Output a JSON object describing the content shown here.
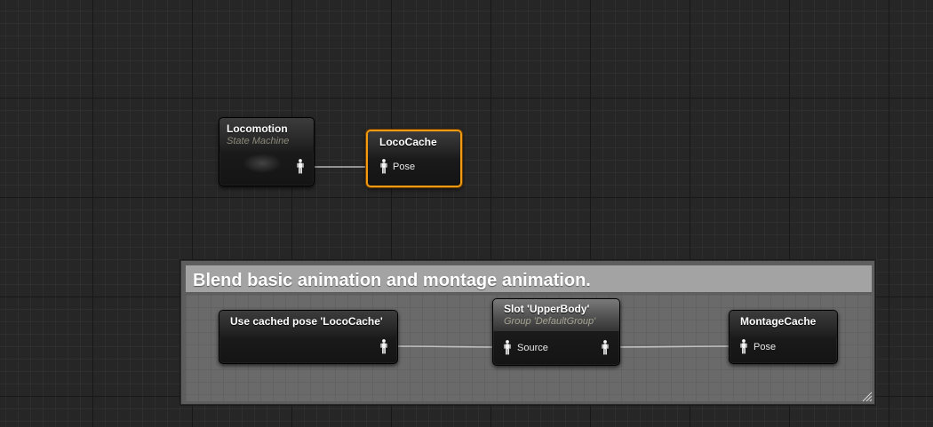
{
  "graph": {
    "comment": {
      "text": "Blend basic animation and montage animation."
    },
    "nodes": {
      "locomotion": {
        "title": "Locomotion",
        "subtitle": "State Machine"
      },
      "loco_cache": {
        "title": "LocoCache",
        "pin_label": "Pose"
      },
      "use_cached_pose": {
        "title": "Use cached pose 'LocoCache'"
      },
      "slot_upper_body": {
        "title": "Slot 'UpperBody'",
        "subtitle": "Group 'DefaultGroup'",
        "pin_label": "Source"
      },
      "montage_cache": {
        "title": "MontageCache",
        "pin_label": "Pose"
      }
    },
    "icons": {
      "pose_pin": "pose-pin-icon",
      "resize": "resize-grip-icon"
    },
    "colors": {
      "background": "#262626",
      "selection": "#f29a12",
      "comment_bar": "#a3a3a3",
      "comment_body": "#6a6a6a",
      "wire": "#cfcfcf",
      "subtitle": "#8c8a7a"
    }
  }
}
